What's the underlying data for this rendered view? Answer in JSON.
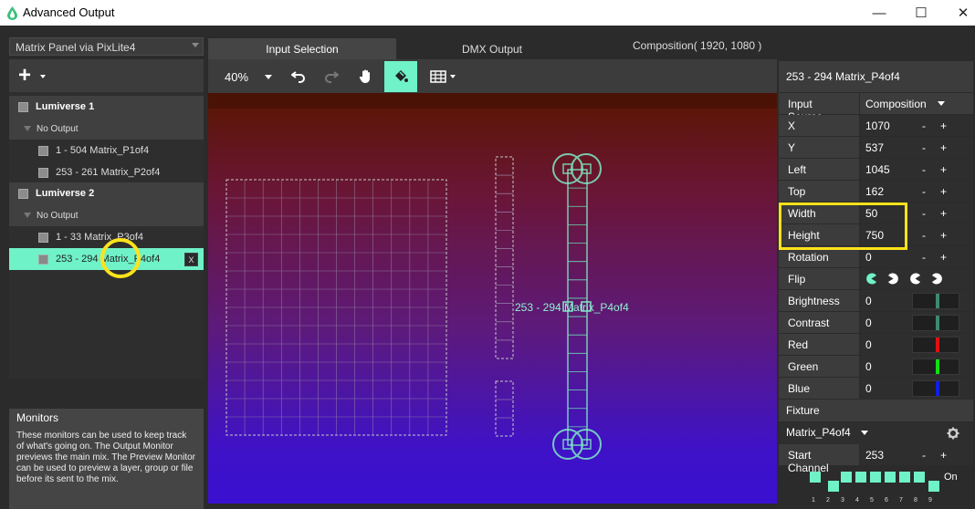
{
  "window": {
    "title": "Advanced Output",
    "minimize": "—",
    "maximize": "☐",
    "close": "✕"
  },
  "left": {
    "panel_select": "Matrix Panel via PixLite4",
    "add_icon": "+",
    "layers": [
      {
        "kind": "group",
        "label": "Lumiverse 1"
      },
      {
        "kind": "sub",
        "label": "No Output"
      },
      {
        "kind": "item",
        "label": "1 - 504 Matrix_P1of4"
      },
      {
        "kind": "item",
        "label": "253 - 261 Matrix_P2of4"
      },
      {
        "kind": "group",
        "label": "Lumiverse 2"
      },
      {
        "kind": "sub",
        "label": "No Output"
      },
      {
        "kind": "item",
        "label": "1 - 33 Matrix_P3of4"
      },
      {
        "kind": "selected",
        "label": "253 - 294 Matrix_P4of4",
        "x_label": "X"
      }
    ],
    "monitors": {
      "title": "Monitors",
      "text": "These monitors can be used to keep track of what's going on. The Output Monitor previews the main mix. The Preview Monitor can be used to preview a layer, group or file before its sent to the mix."
    }
  },
  "tabs": [
    {
      "label": "Input Selection",
      "active": true
    },
    {
      "label": "DMX Output",
      "active": false
    }
  ],
  "composition_label": "Composition( 1920, 1080 )",
  "toolbar": {
    "zoom": "40%",
    "icons": [
      "undo-icon",
      "redo-icon",
      "hand-icon",
      "fill-icon",
      "grid-icon"
    ],
    "accent": "#6ff2c7"
  },
  "canvas": {
    "fixture_label": "253 - 294 Matrix_P4of4"
  },
  "properties": {
    "title": "253 - 294 Matrix_P4of4",
    "input_source": {
      "label": "Input Source",
      "value": "Composition"
    },
    "rows": [
      {
        "key": "x",
        "label": "X",
        "value": "1070"
      },
      {
        "key": "y",
        "label": "Y",
        "value": "537"
      },
      {
        "key": "left",
        "label": "Left",
        "value": "1045"
      },
      {
        "key": "top",
        "label": "Top",
        "value": "162"
      },
      {
        "key": "width",
        "label": "Width",
        "value": "50"
      },
      {
        "key": "height",
        "label": "Height",
        "value": "750"
      },
      {
        "key": "rotation",
        "label": "Rotation",
        "value": "0"
      }
    ],
    "minus": "-",
    "plus": "+",
    "flip": {
      "label": "Flip",
      "icons": [
        "flip-none-icon",
        "flip-horizontal-icon",
        "flip-vertical-icon",
        "flip-both-icon"
      ]
    },
    "colors": [
      {
        "label": "Brightness",
        "value": "0",
        "color": "#3e8a6e"
      },
      {
        "label": "Contrast",
        "value": "0",
        "color": "#3e8a6e"
      },
      {
        "label": "Red",
        "value": "0",
        "color": "#e01010"
      },
      {
        "label": "Green",
        "value": "0",
        "color": "#10e010"
      },
      {
        "label": "Blue",
        "value": "0",
        "color": "#1020e0"
      }
    ],
    "fixture": {
      "title": "Fixture",
      "name": "Matrix_P4of4"
    },
    "start_channel": {
      "label": "Start Channel",
      "value": "253"
    },
    "channels": {
      "numbers": [
        "1",
        "2",
        "3",
        "4",
        "5",
        "6",
        "7",
        "8",
        "9"
      ],
      "on_label": "On"
    }
  },
  "highlight_color": "#ffe21a"
}
